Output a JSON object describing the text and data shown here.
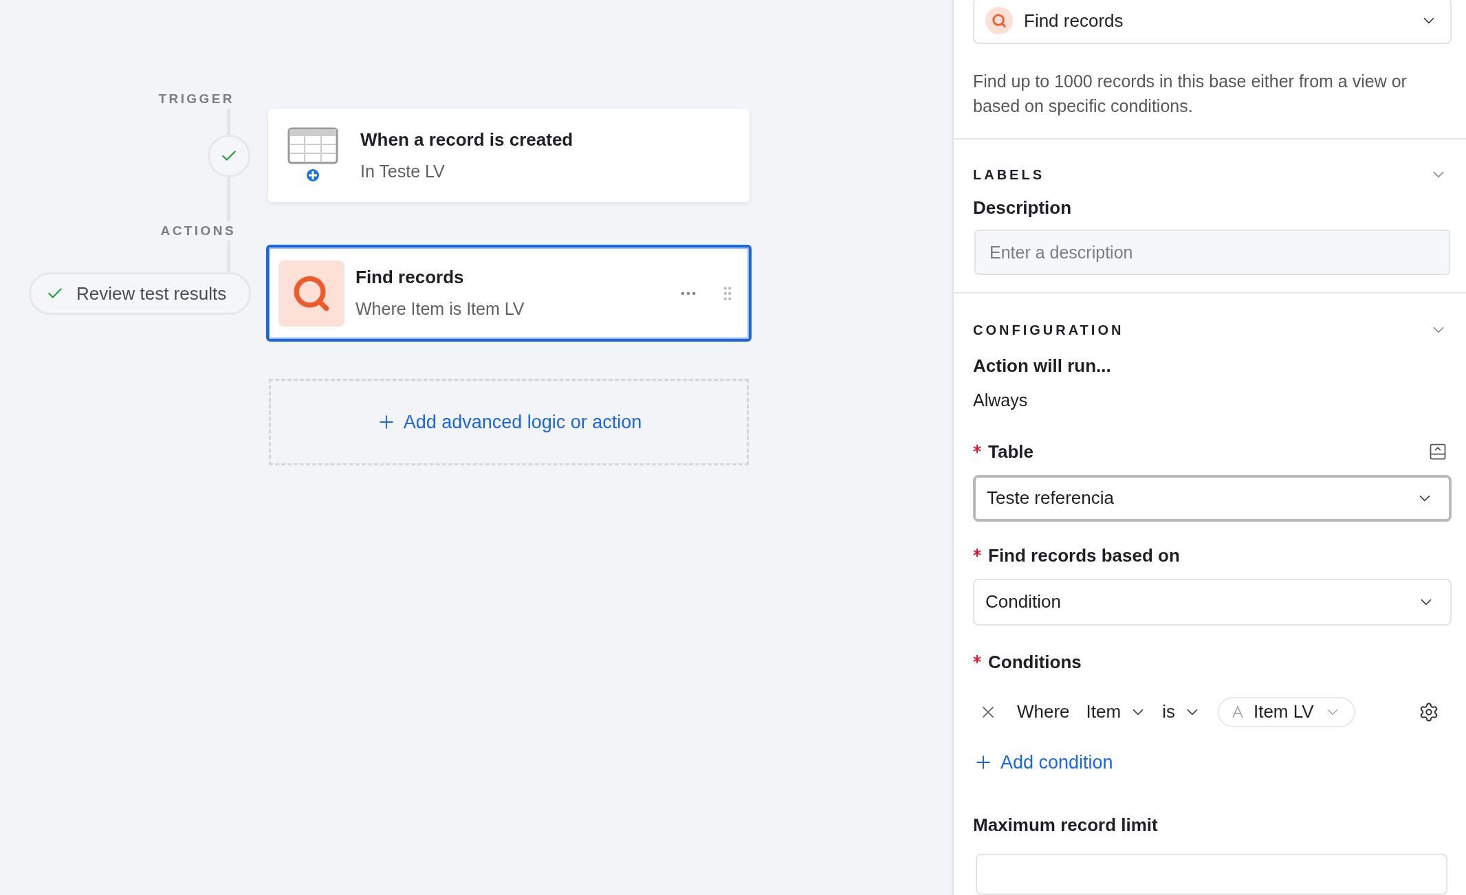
{
  "canvas": {
    "trigger_label": "TRIGGER",
    "actions_label": "ACTIONS",
    "review_button": "Review test results",
    "steps": [
      {
        "kind": "trigger",
        "title": "When a record is created",
        "subtitle": "In Teste LV",
        "selected": false
      },
      {
        "kind": "find",
        "title": "Find records",
        "subtitle": "Where Item is Item LV",
        "selected": true
      }
    ],
    "add_button": "Add advanced logic or action"
  },
  "panel": {
    "action_select": "Find records",
    "description": "Find up to 1000 records in this base either from a view or based on specific conditions.",
    "labels_section": {
      "title": "LABELS",
      "field_label": "Description",
      "placeholder": "Enter a description"
    },
    "configuration": {
      "title": "CONFIGURATION",
      "run_label": "Action will run...",
      "run_value": "Always",
      "fields": [
        {
          "label": "Table",
          "required": true,
          "value": "Teste referencia",
          "focused": true
        },
        {
          "label": "Find records based on",
          "required": true,
          "value": "Condition",
          "focused": false
        }
      ],
      "conditions_label": "Conditions",
      "conditions_required": true,
      "condition": {
        "prefix": "Where",
        "field": "Item",
        "operator": "is",
        "value": "Item LV"
      },
      "add_condition": "Add condition",
      "limit_label": "Maximum record limit"
    }
  }
}
